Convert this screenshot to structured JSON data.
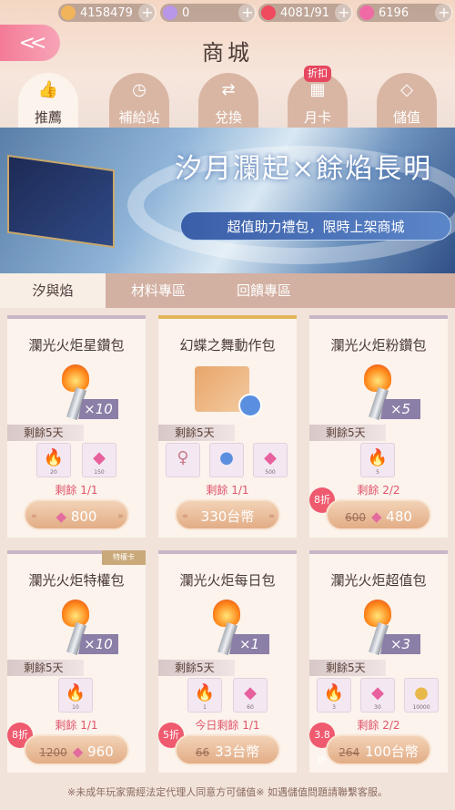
{
  "currency": [
    {
      "icon": "cat-coin-icon",
      "value": "4158479"
    },
    {
      "icon": "diamond-icon",
      "value": "0"
    },
    {
      "icon": "heart-icon",
      "value": "4081/91"
    },
    {
      "icon": "pink-gem-icon",
      "value": "6196"
    }
  ],
  "header": {
    "title": "商城",
    "back_label": "<<"
  },
  "tabs": [
    {
      "label": "推薦",
      "icon": "thumbs-up-icon",
      "active": true,
      "dot": true
    },
    {
      "label": "補給站",
      "icon": "clock-icon",
      "active": false,
      "dot": false
    },
    {
      "label": "兌換",
      "icon": "exchange-icon",
      "active": false,
      "dot": false
    },
    {
      "label": "月卡",
      "icon": "calendar-icon",
      "active": false,
      "dot": false,
      "badge": "折扣"
    },
    {
      "label": "儲值",
      "icon": "diamond-icon",
      "active": false,
      "dot": true
    }
  ],
  "banner": {
    "title": "汐月瀾起×餘焰長明",
    "subtitle": "超值助力禮包，限時上架商城"
  },
  "subtabs": [
    {
      "label": "汐與焰",
      "active": true,
      "dot": false
    },
    {
      "label": "材料專區",
      "active": false,
      "dot": true
    },
    {
      "label": "回饋專區",
      "active": false,
      "dot": false
    }
  ],
  "cards": [
    {
      "name": "瀾光火炬星鑽包",
      "mult": "×10",
      "days": "剩餘5天",
      "items": [
        "20",
        "150"
      ],
      "remain": "剩餘 1/1",
      "price": "800",
      "gem": true,
      "old": "",
      "disc": "",
      "ribbon": ""
    },
    {
      "name": "幻蝶之舞動作包",
      "mult": "",
      "days": "剩餘5天",
      "items": [
        "",
        "",
        "500"
      ],
      "remain": "剩餘 1/1",
      "price": "330台幣",
      "gem": false,
      "old": "",
      "disc": "",
      "ribbon": ""
    },
    {
      "name": "瀾光火炬粉鑽包",
      "mult": "×5",
      "days": "剩餘5天",
      "items": [
        "5"
      ],
      "remain": "剩餘 2/2",
      "price": "480",
      "gem": true,
      "old": "600",
      "disc": "8折",
      "ribbon": ""
    },
    {
      "name": "瀾光火炬特權包",
      "mult": "×10",
      "days": "剩餘5天",
      "items": [
        "10"
      ],
      "remain": "剩餘 1/1",
      "price": "960",
      "gem": true,
      "old": "1200",
      "disc": "8折",
      "ribbon": "特權卡"
    },
    {
      "name": "瀾光火炬每日包",
      "mult": "×1",
      "days": "剩餘5天",
      "items": [
        "1",
        "60"
      ],
      "remain": "今日剩餘 1/1",
      "price": "33台幣",
      "gem": false,
      "old": "66",
      "disc": "5折",
      "ribbon": ""
    },
    {
      "name": "瀾光火炬超值包",
      "mult": "×3",
      "days": "剩餘5天",
      "items": [
        "3",
        "30",
        "10000"
      ],
      "remain": "剩餘 2/2",
      "price": "100台幣",
      "gem": false,
      "old": "264",
      "disc": "3.8折",
      "ribbon": ""
    }
  ],
  "footer": "※未成年玩家需經法定代理人同意方可儲值※ 如遇儲值問題請聯繫客服。"
}
